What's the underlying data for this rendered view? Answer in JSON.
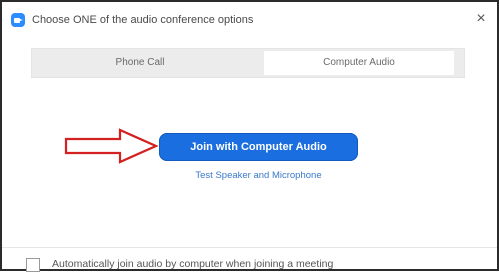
{
  "window": {
    "title": "Choose ONE of the audio conference options",
    "close_glyph": "×",
    "app_icon": "zoom-camera-icon"
  },
  "tabs": [
    {
      "label": "Phone Call",
      "selected": false
    },
    {
      "label": "Computer Audio",
      "selected": true
    }
  ],
  "main": {
    "join_button_label": "Join with Computer Audio",
    "test_link_label": "Test Speaker and Microphone",
    "annotation_arrow": "red-outline-arrow-icon"
  },
  "footer": {
    "auto_join_label": "Automatically join audio by computer when joining a meeting",
    "auto_join_checked": false
  },
  "colors": {
    "button_blue": "#1a6ee0",
    "link_blue": "#3a79c9",
    "arrow_red": "#d32020",
    "tab_bar": "#ececec"
  }
}
